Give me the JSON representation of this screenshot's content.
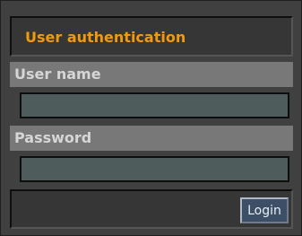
{
  "title": "User authentication",
  "username": {
    "label": "User name",
    "value": ""
  },
  "password": {
    "label": "Password",
    "value": ""
  },
  "login_button": "Login",
  "colors": {
    "title_accent": "#f39a0c",
    "panel_background": "#404040",
    "label_bar": "#787878",
    "input_background": "#4e5d5b",
    "button_background": "#3c4f66"
  }
}
